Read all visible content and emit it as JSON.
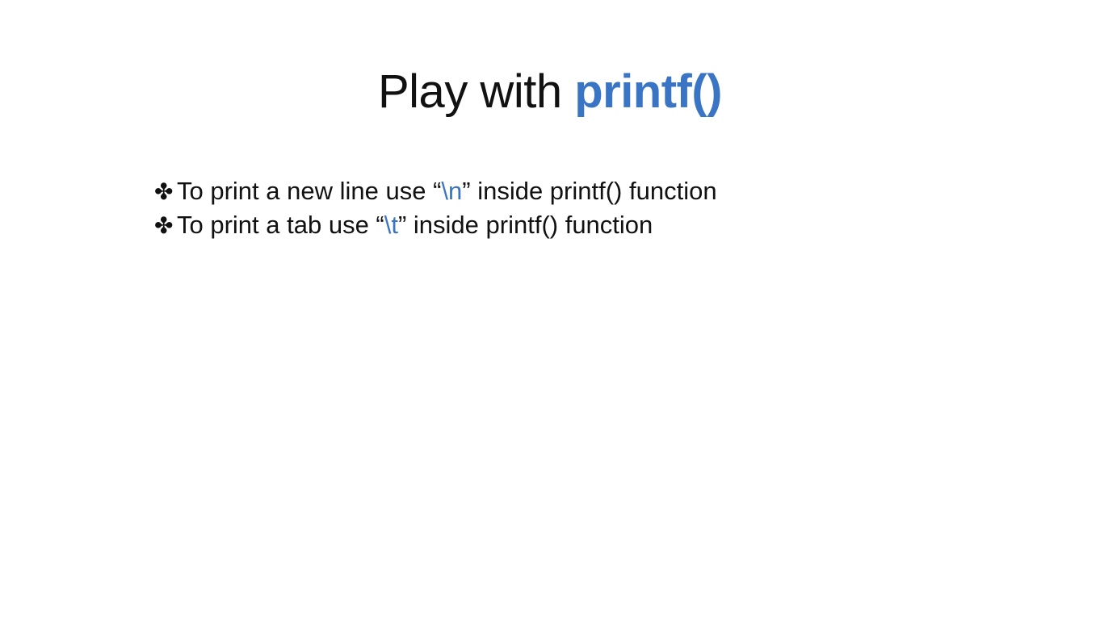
{
  "slide": {
    "title": {
      "prefix": "Play with ",
      "highlight": "printf()"
    },
    "bullets": [
      {
        "icon": "four-club-spoked-asterisk-icon",
        "glyph": "✤",
        "before": "To print a new line use “",
        "code": "\\n",
        "after": "” inside printf() function"
      },
      {
        "icon": "four-club-spoked-asterisk-icon",
        "glyph": "✤",
        "before": "To print a tab use “",
        "code": "\\t",
        "after": "” inside printf() function"
      }
    ],
    "colors": {
      "text": "#111111",
      "accent": "#3a74c4",
      "background": "#ffffff"
    }
  }
}
